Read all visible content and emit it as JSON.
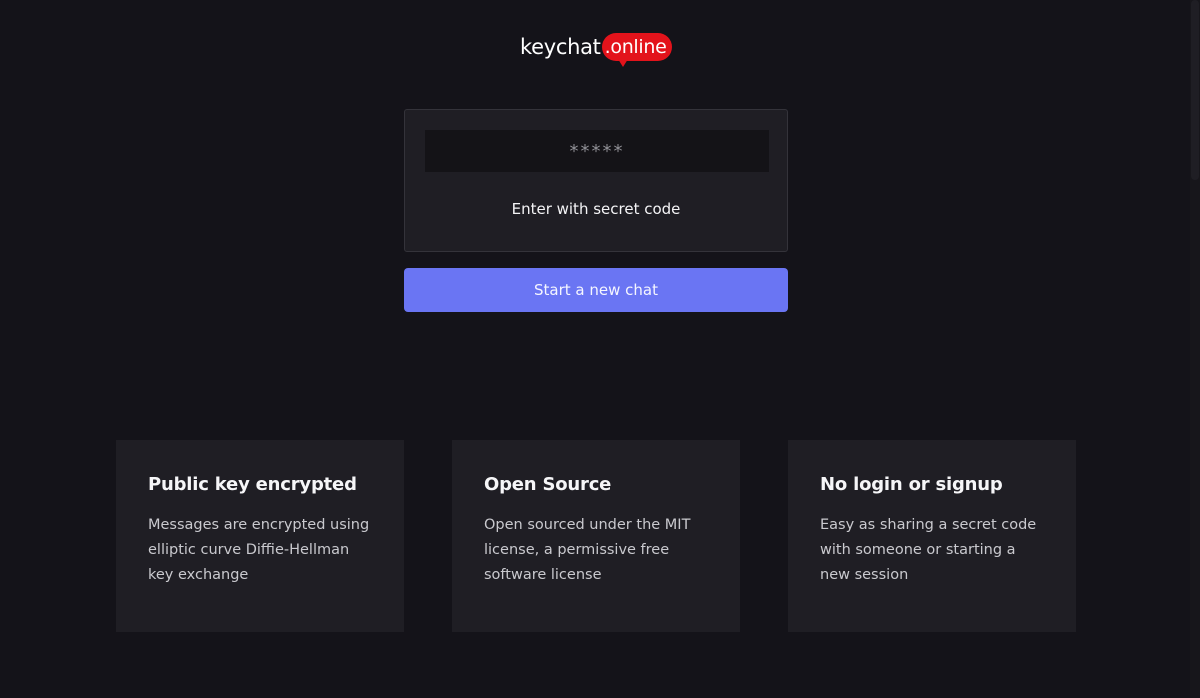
{
  "logo": {
    "name": "keychat",
    "badge": ".online"
  },
  "code_panel": {
    "input_placeholder": "*****",
    "input_value": "",
    "enter_label": "Enter with secret code"
  },
  "start_button": {
    "label": "Start a new chat"
  },
  "features": [
    {
      "title": "Public key encrypted",
      "description": "Messages are encrypted using elliptic curve Diffie-Hellman key exchange"
    },
    {
      "title": "Open Source",
      "description": "Open sourced under the MIT license, a permissive free software license"
    },
    {
      "title": "No login or signup",
      "description": "Easy as sharing a secret code with someone or starting a new session"
    }
  ],
  "colors": {
    "background": "#141319",
    "panel": "#1f1e24",
    "accent": "#6a75f3",
    "brand_red": "#e3131b"
  }
}
